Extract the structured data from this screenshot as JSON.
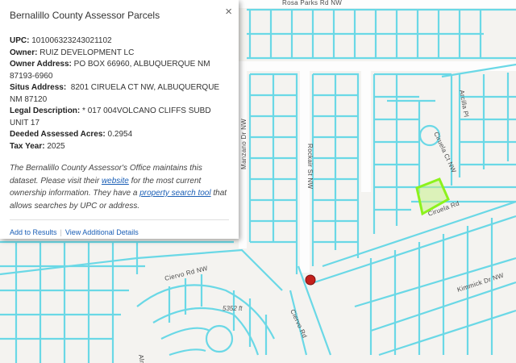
{
  "popup": {
    "title": "Bernalillo County Assessor Parcels",
    "close_icon": "×",
    "fields": [
      {
        "label": "UPC:",
        "value": "101006323243021102"
      },
      {
        "label": "Owner:",
        "value": "RUIZ DEVELOPMENT LC"
      },
      {
        "label": "Owner Address:",
        "value": "PO BOX 66960, ALBUQUERQUE NM 87193-6960"
      },
      {
        "label": "Situs Address:",
        "value": "8201 CIRUELA CT NW, ALBUQUERQUE NM 87120"
      },
      {
        "label": "Legal Description:",
        "value": "* 017 004VOLCANO CLIFFS SUBD UNIT 17"
      },
      {
        "label": "Deeded Assessed Acres:",
        "value": "0.2954"
      },
      {
        "label": "Tax Year:",
        "value": "2025"
      }
    ],
    "desc_part1": "The Bernalillo County Assessor's Office maintains this dataset. Please visit their ",
    "website_link": "website",
    "desc_part2": " for the most current ownership information. They have a ",
    "search_link": "property search tool",
    "desc_part3": " that allows searches by UPC or address.",
    "add_to_results": "Add to Results",
    "separator": "|",
    "view_details": "View Additional Details"
  },
  "map": {
    "parcel_color": "#6ad8e6",
    "highlight_color": "#8cf21c",
    "marker_color": "#c4201b",
    "labels": {
      "rosa_parks": "Rosa Parks Rd NW",
      "arcilla": "Arcilla Pl",
      "manzano": "Manzano Dr NW",
      "rockair": "Rockair St NW",
      "ciruela_ct": "Ciruela Ct NW",
      "ciruela_rd": "Ciruela Rd",
      "kimmick": "Kimmick Dr NW",
      "ciervo_nw": "Ciervo Rd NW",
      "ciervo_rd": "Ciervo Rd",
      "elevation": "5352 ft",
      "alm": "Alm"
    }
  }
}
